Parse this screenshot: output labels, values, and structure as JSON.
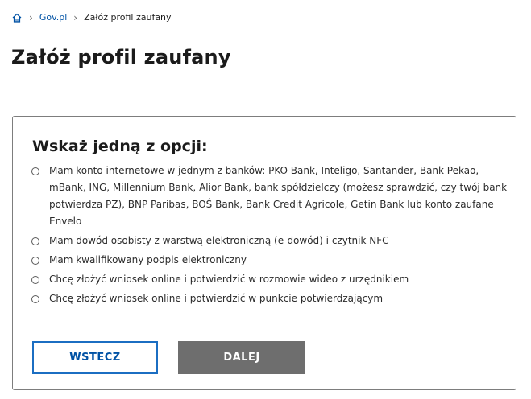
{
  "breadcrumb": {
    "home_icon": "home-icon",
    "separator": "›",
    "link": "Gov.pl",
    "current": "Załóż profil zaufany"
  },
  "page": {
    "title": "Załóż profil zaufany"
  },
  "form": {
    "heading": "Wskaż jedną z opcji:",
    "options": [
      {
        "label": "Mam konto internetowe w jednym z banków: PKO Bank, Inteligo, Santander, Bank Pekao, mBank, ING, Millennium Bank, Alior Bank, bank spółdzielczy (możesz sprawdzić, czy twój bank potwierdza PZ), BNP Paribas, BOŚ Bank, Bank Credit Agricole, Getin Bank lub konto zaufane Envelo",
        "selected": false
      },
      {
        "label": "Mam dowód osobisty z warstwą elektroniczną (e-dowód) i czytnik NFC",
        "selected": false
      },
      {
        "label": "Mam kwalifikowany podpis elektroniczny",
        "selected": false
      },
      {
        "label": "Chcę złożyć wniosek online i potwierdzić w rozmowie wideo z urzędnikiem",
        "selected": false
      },
      {
        "label": "Chcę złożyć wniosek online i potwierdzić w punkcie potwierdzającym",
        "selected": false
      }
    ],
    "back_label": "WSTECZ",
    "next_label": "DALEJ"
  },
  "colors": {
    "link": "#0052a5",
    "button_border": "#1b6ec2",
    "button_disabled": "#6e6e6e",
    "panel_border": "#7d7d7d"
  }
}
